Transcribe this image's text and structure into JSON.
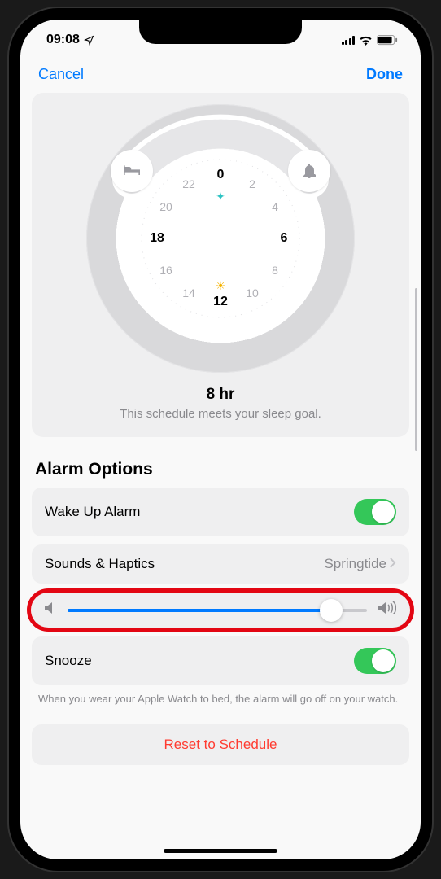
{
  "status": {
    "time": "09:08"
  },
  "nav": {
    "cancel": "Cancel",
    "done": "Done"
  },
  "wheel": {
    "hours": [
      "0",
      "2",
      "4",
      "6",
      "8",
      "10",
      "12",
      "14",
      "16",
      "18",
      "20",
      "22"
    ],
    "bold_hours": [
      "0",
      "6",
      "12",
      "18"
    ],
    "summary_duration": "8 hr",
    "summary_text": "This schedule meets your sleep goal."
  },
  "alarm": {
    "section_title": "Alarm Options",
    "wake_up_label": "Wake Up Alarm",
    "wake_up_on": true,
    "sounds_label": "Sounds & Haptics",
    "sounds_value": "Springtide",
    "volume_pct": 88,
    "snooze_label": "Snooze",
    "snooze_on": true,
    "footnote": "When you wear your Apple Watch to bed, the alarm will go off on your watch."
  },
  "reset": {
    "label": "Reset to Schedule"
  }
}
